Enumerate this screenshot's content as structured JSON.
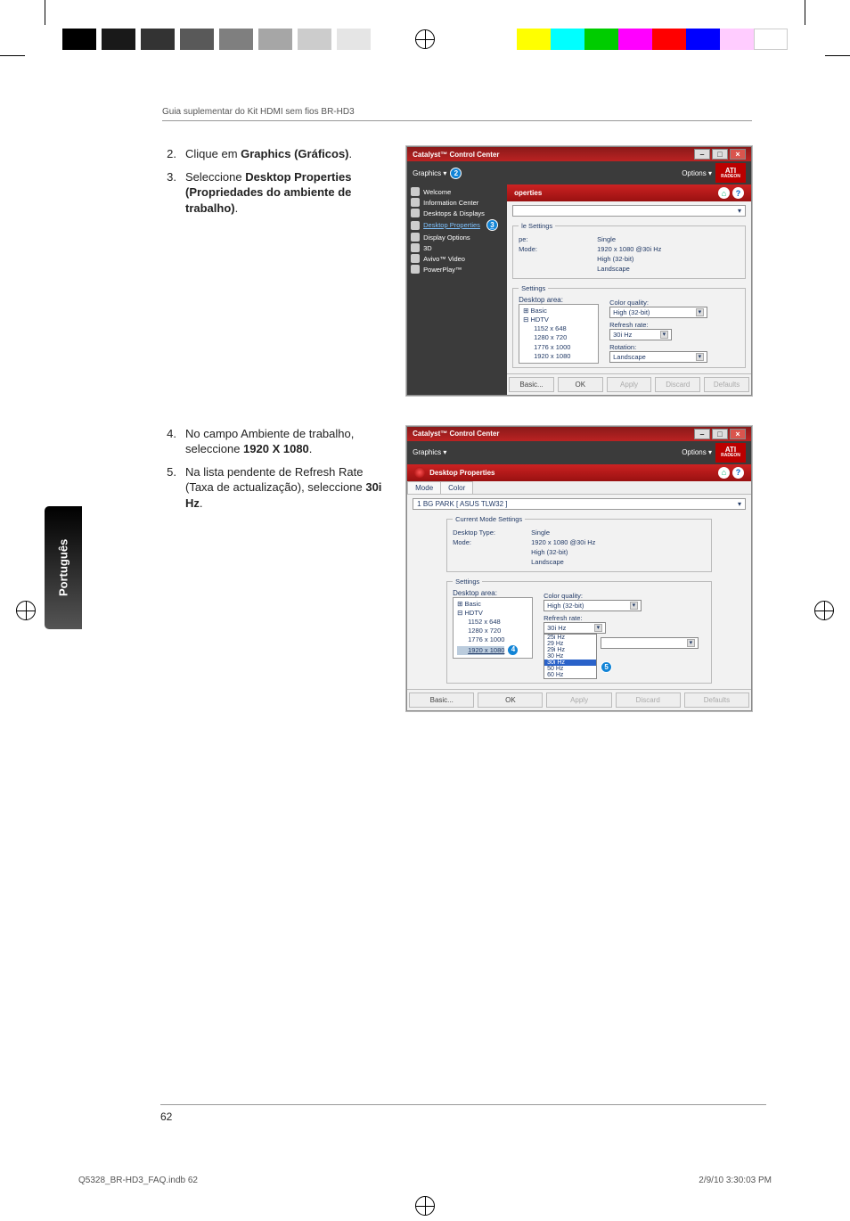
{
  "print": {
    "header": "Guia suplementar do Kit HDMI sem fios BR-HD3",
    "side_tab": "Português",
    "page_number": "62",
    "slug_left": "Q5328_BR-HD3_FAQ.indb   62",
    "slug_right": "2/9/10   3:30:03 PM"
  },
  "steps": {
    "s2_num": "2.",
    "s2_pre": "Clique em ",
    "s2_bold": "Graphics (Gráficos)",
    "s2_post": ".",
    "s3_num": "3.",
    "s3_pre": "Seleccione ",
    "s3_bold": "Desktop Properties (Propriedades do ambiente de trabalho)",
    "s3_post": ".",
    "s4_num": "4.",
    "s4_pre": "No campo Ambiente de trabalho, seleccione ",
    "s4_bold": "1920 X 1080",
    "s4_post": ".",
    "s5_num": "5.",
    "s5_pre": "Na lista pendente de Refresh Rate (Taxa de actualização), seleccione ",
    "s5_bold": "30i Hz",
    "s5_post": "."
  },
  "ccc": {
    "title": "Catalyst™ Control Center",
    "menu_graphics": "Graphics ▾",
    "menu_options": "Options ▾",
    "ati_top": "ATI",
    "ati_bottom": "RADEON",
    "head_label": "Desktop Properties",
    "head_label_partial": "operties",
    "sidebar": {
      "welcome": "Welcome",
      "info": "Information Center",
      "desktops": "Desktops & Displays",
      "props": "Desktop Properties",
      "dispopt": "Display Options",
      "threed": "3D",
      "avivo": "Avivo™ Video",
      "powerplay": "PowerPlay™"
    },
    "tabs": {
      "mode": "Mode",
      "color": "Color"
    },
    "device": "1 BG PARK [ ASUS TLW32 ]",
    "cms_legend": "Current Mode Settings",
    "cms_partial_legend": "le Settings",
    "cms_partial_k1": "pe:",
    "cms": {
      "k_type": "Desktop Type:",
      "v_type": "Single",
      "k_mode": "Mode:",
      "v_mode": "1920 x 1080 @30i Hz",
      "v_color": "High (32-bit)",
      "v_orient": "Landscape"
    },
    "settings_legend": "Settings",
    "lbl_area": "Desktop area:",
    "lbl_cq": "Color quality:",
    "lbl_rr": "Refresh rate:",
    "lbl_rot": "Rotation:",
    "tree": {
      "basic": "⊞ Basic",
      "hdtv": "⊟ HDTV",
      "r1": "1152 x  648",
      "r2": "1280 x  720",
      "r3": "1776 x 1000",
      "r4": "1920 x 1080"
    },
    "dd_cq": "High (32-bit)",
    "dd_rr": "30i Hz",
    "dd_rot": "Landscape",
    "rr_list": {
      "o1": "25i Hz",
      "o2": "29 Hz",
      "o3": "29i Hz",
      "o4": "30 Hz",
      "o5": "30i Hz",
      "o6": "50 Hz",
      "o7": "60 Hz"
    },
    "buttons": {
      "basic": "Basic...",
      "ok": "OK",
      "apply": "Apply",
      "discard": "Discard",
      "defaults": "Defaults"
    }
  },
  "callouts": {
    "n2": "2",
    "n3": "3",
    "n4": "4",
    "n5": "5"
  }
}
